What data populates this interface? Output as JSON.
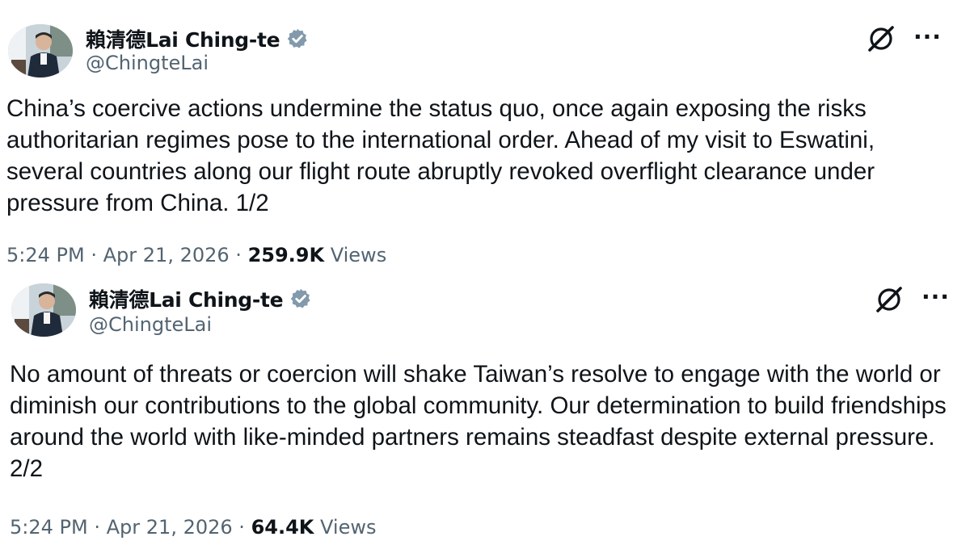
{
  "tweets": [
    {
      "display_name": "賴清德Lai Ching-te",
      "handle": "@ChingteLai",
      "text": "China’s coercive actions undermine the status quo, once again exposing the risks authoritarian regimes pose to the international order. Ahead of my visit to Eswatini, several countries along our flight route abruptly revoked overflight clearance under pressure from China. 1/2",
      "time": "5:24 PM",
      "date": "Apr 21, 2026",
      "separator": "·",
      "views_count": "259.9K",
      "views_label": "Views",
      "verified_icon": "verified-badge-icon",
      "grok_icon": "grok-icon",
      "more_icon": "more-options-icon"
    },
    {
      "display_name": "賴清德Lai Ching-te",
      "handle": "@ChingteLai",
      "text": "No amount of threats or coercion will shake Taiwan’s resolve to engage with the world or diminish our contributions to the global community. Our determination to build friendships around the world with like-minded partners remains steadfast despite external pressure. 2/2",
      "time": "5:24 PM",
      "date": "Apr 21, 2026",
      "separator": "·",
      "views_count": "64.4K",
      "views_label": "Views",
      "verified_icon": "verified-badge-icon",
      "grok_icon": "grok-icon",
      "more_icon": "more-options-icon"
    }
  ],
  "colors": {
    "text_primary": "#0f1419",
    "text_secondary": "#536471",
    "verified_badge": "#829aab",
    "background": "#ffffff"
  },
  "more_glyph": "···"
}
